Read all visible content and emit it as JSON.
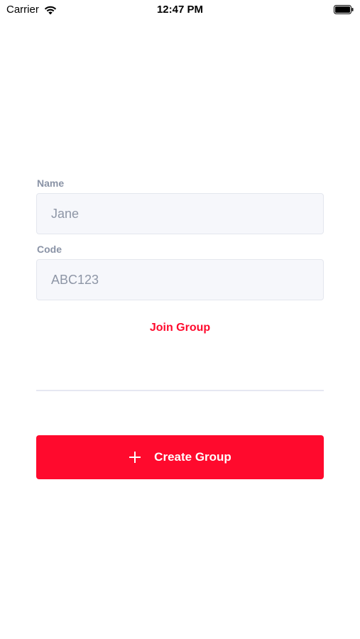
{
  "status_bar": {
    "carrier": "Carrier",
    "time": "12:47 PM",
    "wifi_icon": "wifi-icon",
    "battery_icon": "battery-icon"
  },
  "form": {
    "name_label": "Name",
    "name_placeholder": "Jane",
    "code_label": "Code",
    "code_placeholder": "ABC123",
    "join_label": "Join Group"
  },
  "create": {
    "label": "Create Group",
    "icon": "plus-icon"
  },
  "colors": {
    "accent": "#ff0a2d",
    "label": "#8a93a6",
    "input_bg": "#f6f7fb",
    "divider": "#e6e8f2"
  }
}
